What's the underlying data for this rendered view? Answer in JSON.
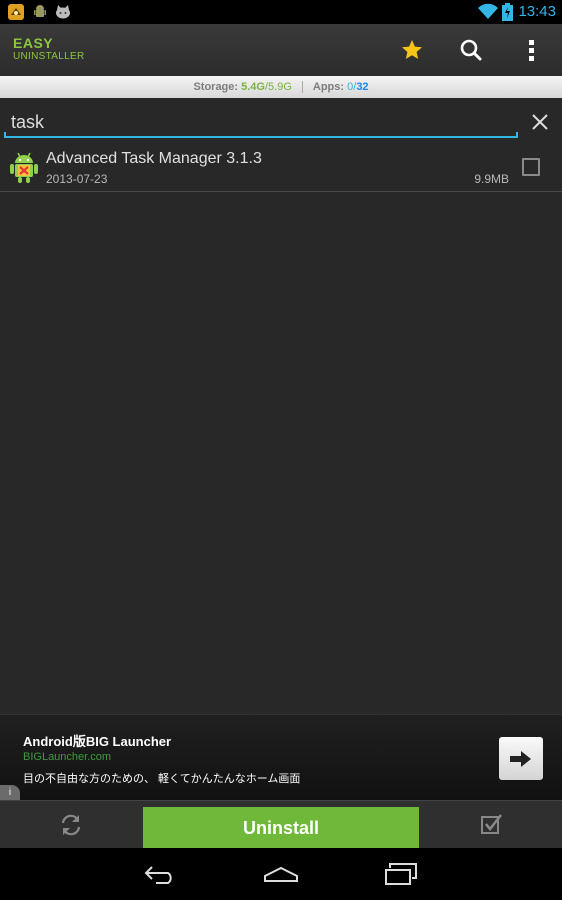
{
  "status_bar": {
    "notification_icons": [
      "bird-game-icon",
      "android-robot-icon",
      "cat-face-icon"
    ],
    "time": "13:43"
  },
  "app": {
    "logo_line1": "EASY",
    "logo_line2": "UNINSTALLER",
    "actions": [
      "star-icon",
      "search-icon",
      "overflow-menu-icon"
    ]
  },
  "storage": {
    "storage_label": "Storage:",
    "storage_used": "5.4G",
    "storage_total": "/5.9G",
    "apps_label": "Apps:",
    "apps_selected": "0",
    "apps_slash": "/",
    "apps_total": "32"
  },
  "search": {
    "value": "task",
    "placeholder": ""
  },
  "apps": [
    {
      "name": "Advanced Task Manager 3.1.3",
      "date": "2013-07-23",
      "size": "9.9MB",
      "checked": false
    }
  ],
  "ad": {
    "title": "Android版BIG Launcher",
    "url": "BIGLauncher.com",
    "description": "目の不自由な方のための、 軽くてかんたんなホーム画面",
    "info": "i"
  },
  "bottom_bar": {
    "uninstall_label": "Uninstall"
  },
  "colors": {
    "accent_green": "#8dc63f",
    "uninstall_green": "#6fb83a",
    "accent_blue": "#33b5e5",
    "background": "#282828"
  }
}
